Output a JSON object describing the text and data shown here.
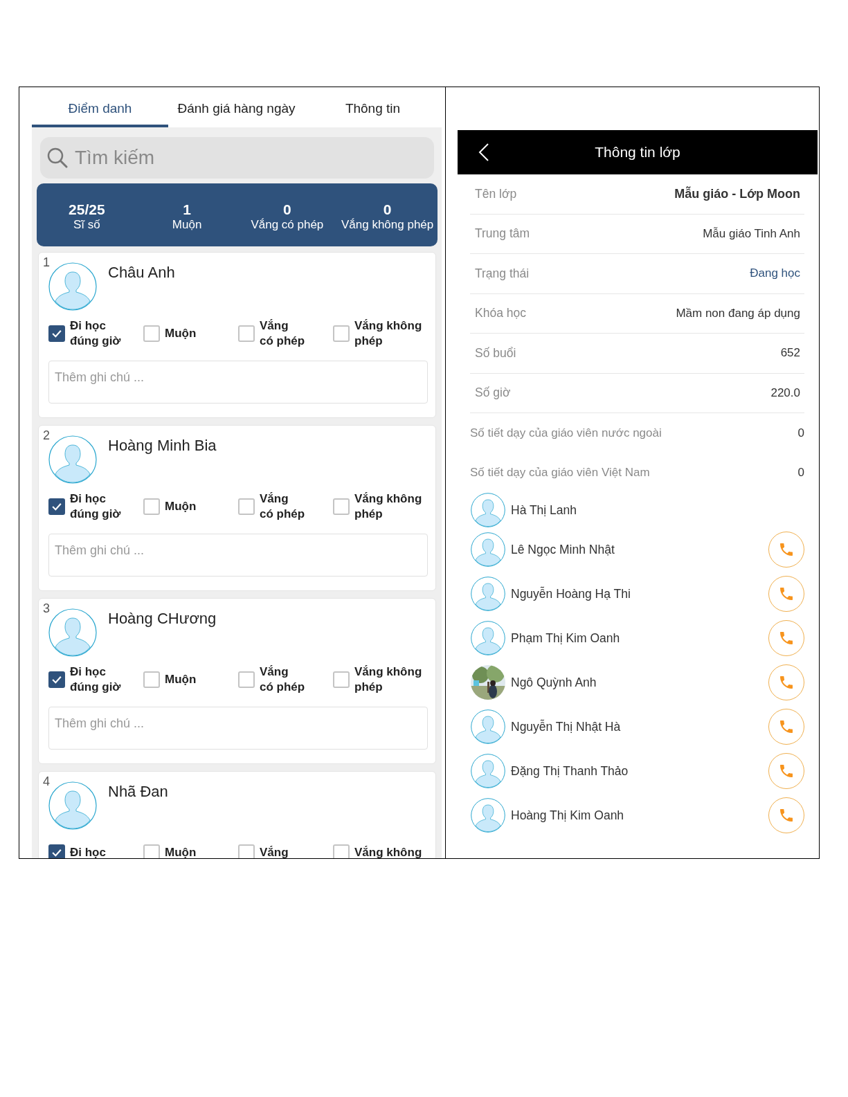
{
  "attendance": {
    "tabs": [
      {
        "label": "Điểm danh",
        "selected": true
      },
      {
        "label": "Đánh giá hàng ngày",
        "selected": false
      },
      {
        "label": "Thông tin",
        "selected": false
      }
    ],
    "search": {
      "placeholder": "Tìm kiếm"
    },
    "stats": [
      {
        "value": "25/25",
        "label": "Sĩ số"
      },
      {
        "value": "1",
        "label": "Muộn"
      },
      {
        "value": "0",
        "label": "Vắng có phép"
      },
      {
        "value": "0",
        "label": "Vắng không phép"
      }
    ],
    "students": [
      {
        "number": "1",
        "name": "Châu Anh",
        "options": [
          {
            "label": "Đi học\nđúng giờ",
            "checked": true
          },
          {
            "label": "Muộn",
            "checked": false
          },
          {
            "label": "Vắng\ncó phép",
            "checked": false
          },
          {
            "label": "Vắng không\nphép",
            "checked": false
          }
        ],
        "note": {
          "placeholder": "Thêm ghi chú ..."
        }
      },
      {
        "number": "2",
        "name": "Hoàng Minh Bia",
        "options": [
          {
            "label": "Đi học\nđúng giờ",
            "checked": true
          },
          {
            "label": "Muộn",
            "checked": false
          },
          {
            "label": "Vắng\ncó phép",
            "checked": false
          },
          {
            "label": "Vắng không\nphép",
            "checked": false
          }
        ],
        "note": {
          "placeholder": "Thêm ghi chú ..."
        }
      },
      {
        "number": "3",
        "name": "Hoàng CHương",
        "options": [
          {
            "label": "Đi học\nđúng giờ",
            "checked": true
          },
          {
            "label": "Muộn",
            "checked": false
          },
          {
            "label": "Vắng\ncó phép",
            "checked": false
          },
          {
            "label": "Vắng không\nphép",
            "checked": false
          }
        ],
        "note": {
          "placeholder": "Thêm ghi chú ..."
        }
      },
      {
        "number": "4",
        "name": "Nhã Đan",
        "options": [
          {
            "label": "Đi học",
            "checked": true
          },
          {
            "label": "Muộn",
            "checked": false
          },
          {
            "label": "Vắng",
            "checked": false
          },
          {
            "label": "Vắng không",
            "checked": false
          }
        ]
      }
    ]
  },
  "class_info": {
    "title": "Thông tin lớp",
    "rows": [
      {
        "label": "Tên lớp",
        "value": "Mẫu giáo - Lớp Moon",
        "kind": "bold",
        "divider": true
      },
      {
        "label": "Trung tâm",
        "value": "Mẫu giáo Tinh Anh",
        "kind": "plain",
        "divider": true
      },
      {
        "label": "Trạng thái",
        "value": "Đang học",
        "kind": "status",
        "divider": true
      },
      {
        "label": "Khóa học",
        "value": "Mầm non đang áp dụng",
        "kind": "plain",
        "divider": true
      },
      {
        "label": "Số buổi",
        "value": "652",
        "kind": "plain",
        "divider": true
      },
      {
        "label": "Số giờ",
        "value": "220.0",
        "kind": "plain",
        "divider": true
      },
      {
        "label": "Số tiết dạy của giáo viên nước ngoài",
        "value": "0",
        "kind": "plain",
        "divider": false
      },
      {
        "label": "Số tiết dạy của giáo viên Việt Nam",
        "value": "0",
        "kind": "plain",
        "divider": false
      }
    ],
    "teachers": [
      {
        "name": "Hà Thị Lanh",
        "kind": "avatar",
        "call": false
      },
      {
        "name": "Lê Ngọc Minh Nhật",
        "kind": "avatar",
        "call": true
      },
      {
        "name": "Nguyễn Hoàng Hạ Thi",
        "kind": "avatar",
        "call": true
      },
      {
        "name": "Phạm Thị Kim Oanh",
        "kind": "avatar",
        "call": true
      },
      {
        "name": "Ngô Quỳnh Anh",
        "kind": "picture",
        "call": true
      },
      {
        "name": "Nguyễn Thị Nhật Hà",
        "kind": "avatar",
        "call": true
      },
      {
        "name": "Đặng Thị Thanh Thảo",
        "kind": "avatar",
        "call": true
      },
      {
        "name": "Hoàng Thị Kim Oanh",
        "kind": "avatar",
        "call": true
      }
    ]
  }
}
